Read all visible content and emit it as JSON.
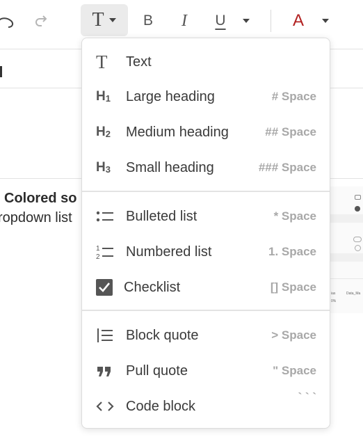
{
  "toolbar": {
    "icons": [
      "undo-icon",
      "redo-icon",
      "text-style-icon",
      "chevron-down-icon",
      "bold-icon",
      "italic-icon",
      "underline-icon",
      "chevron-down-icon",
      "font-color-icon",
      "chevron-down-icon"
    ],
    "bold_glyph": "B",
    "italic_glyph": "I",
    "underline_glyph": "U",
    "font_color_glyph": "A",
    "text_style_glyph": "T",
    "font_color": "#b22222"
  },
  "background": {
    "heading_fragment": "Colored so",
    "subtext_fragment": "ropdown list",
    "thumb_text_1": "ias",
    "thumb_text_2": "Data_Ma",
    "thumb_text_3": "0%"
  },
  "menu": {
    "groups": [
      {
        "items": [
          {
            "label": "Text",
            "shortcut": "",
            "icon": "text-icon"
          },
          {
            "label": "Large heading",
            "shortcut": "# Space",
            "icon": "heading-1-icon"
          },
          {
            "label": "Medium heading",
            "shortcut": "## Space",
            "icon": "heading-2-icon"
          },
          {
            "label": "Small heading",
            "shortcut": "### Space",
            "icon": "heading-3-icon"
          }
        ]
      },
      {
        "items": [
          {
            "label": "Bulleted list",
            "shortcut": "* Space",
            "icon": "bulleted-list-icon"
          },
          {
            "label": "Numbered list",
            "shortcut": "1. Space",
            "icon": "numbered-list-icon"
          },
          {
            "label": "Checklist",
            "shortcut": "[] Space",
            "icon": "checklist-icon"
          }
        ]
      },
      {
        "items": [
          {
            "label": "Block quote",
            "shortcut": "> Space",
            "icon": "block-quote-icon"
          },
          {
            "label": "Pull quote",
            "shortcut": "\" Space",
            "icon": "pull-quote-icon"
          },
          {
            "label": "Code block",
            "shortcut": "` ` `",
            "icon": "code-block-icon"
          }
        ]
      }
    ],
    "heading_icons": {
      "h1": "H",
      "h1_sub": "1",
      "h2": "H",
      "h2_sub": "2",
      "h3": "H",
      "h3_sub": "3"
    },
    "numbered_icon_digits": {
      "one": "1",
      "two": "2"
    }
  },
  "colors": {
    "icon_gray": "#555555",
    "shortcut_gray": "#a8a8a8",
    "checkbox_fill": "#555555",
    "toolbar_active_bg": "#ebebeb"
  }
}
